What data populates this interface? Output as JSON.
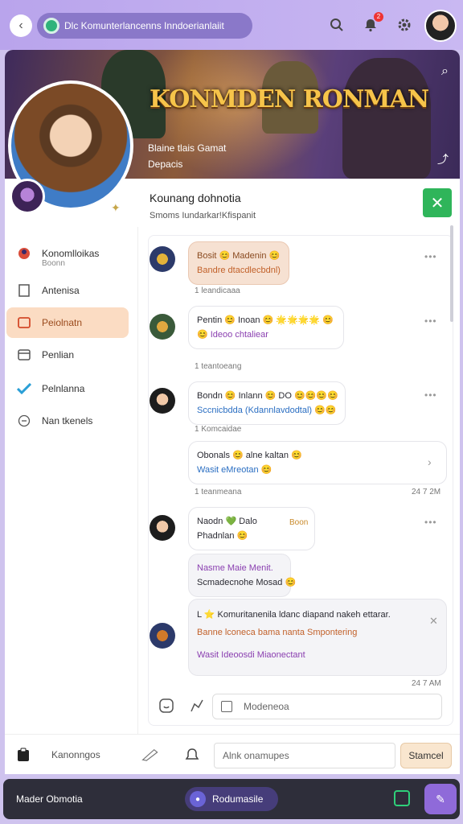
{
  "topbar": {
    "url_text": "Dlc Komunterlancenns Inndoerianlaiit",
    "notification_count": "2"
  },
  "banner": {
    "game_title": "KONMDEN RONMAN",
    "subtitle_line1": "Blaine tlais Gamat",
    "subtitle_line2": "Depacis"
  },
  "sidebar": {
    "items": [
      {
        "label": "Konomlloikas",
        "sub": "Boonn",
        "icon": "user-badge-icon"
      },
      {
        "label": "Antenisa",
        "icon": "bookmark-icon"
      },
      {
        "label": "Peiolnatn",
        "icon": "image-icon",
        "active": true
      },
      {
        "label": "Penlian",
        "icon": "window-icon"
      },
      {
        "label": "Pelnlanna",
        "icon": "check-icon"
      },
      {
        "label": "Nan tkenels",
        "icon": "chat-circle-icon"
      }
    ]
  },
  "chat": {
    "title": "Kounang dohnotia",
    "subtitle": "Smoms Iundarkar!Kfispanit",
    "messages": [
      {
        "line1": "Bosit 😊 Madenin 😊",
        "line2": "Bandre dtacdlecbdnl)"
      },
      {
        "line1": "Pentin 😊 Inoan 😊 🌟🌟🌟🌟 😊",
        "line2": "😊 Ideoo chtaliear"
      },
      {
        "line1": "Bondn 😊 Inlann 😊 DO 😊😊😊😊",
        "line2": "Sccnicbdda (Kdannlavdodtal) 😊😊"
      },
      {
        "line1": "Obonals 😊 alne kaltan 😊",
        "line2": "Wasit eMreotan 😊"
      },
      {
        "line1": "Naodn 💚 Dalo",
        "line1_extra": "Boon",
        "line2": "Phadnlan 😊"
      },
      {
        "line1": "Nasme Maie Menit.",
        "line2": "Scmadecnohe Mosad 😊"
      },
      {
        "line1": "L ⭐ Komuritanenila ldanc diapand nakeh ettarar.",
        "line2": "Banne lconeca bama nanta Smpontering",
        "line3": "Wasit Ideoosdi Miaonectant"
      }
    ],
    "meta": {
      "m1": "1 leandicaaa",
      "m2": "1 teantoeang",
      "m3": "1 Komcaidae",
      "m4": "1 teanmeana",
      "m4_time": "24 7 2M",
      "time_last": "24 7 AM"
    },
    "composer_placeholder": "Modeneoa"
  },
  "toolbar": {
    "text": "Kanonngos",
    "input_placeholder": "Alnk onamupes",
    "button_label": "Stamcel"
  },
  "bottom_nav": {
    "left_label": "Mader Obmotia",
    "pill_label": "Rodumasile"
  },
  "colors": {
    "accent_purple": "#8f6ad9",
    "active_item": "#fbdcc3",
    "green": "#2fb55a"
  }
}
